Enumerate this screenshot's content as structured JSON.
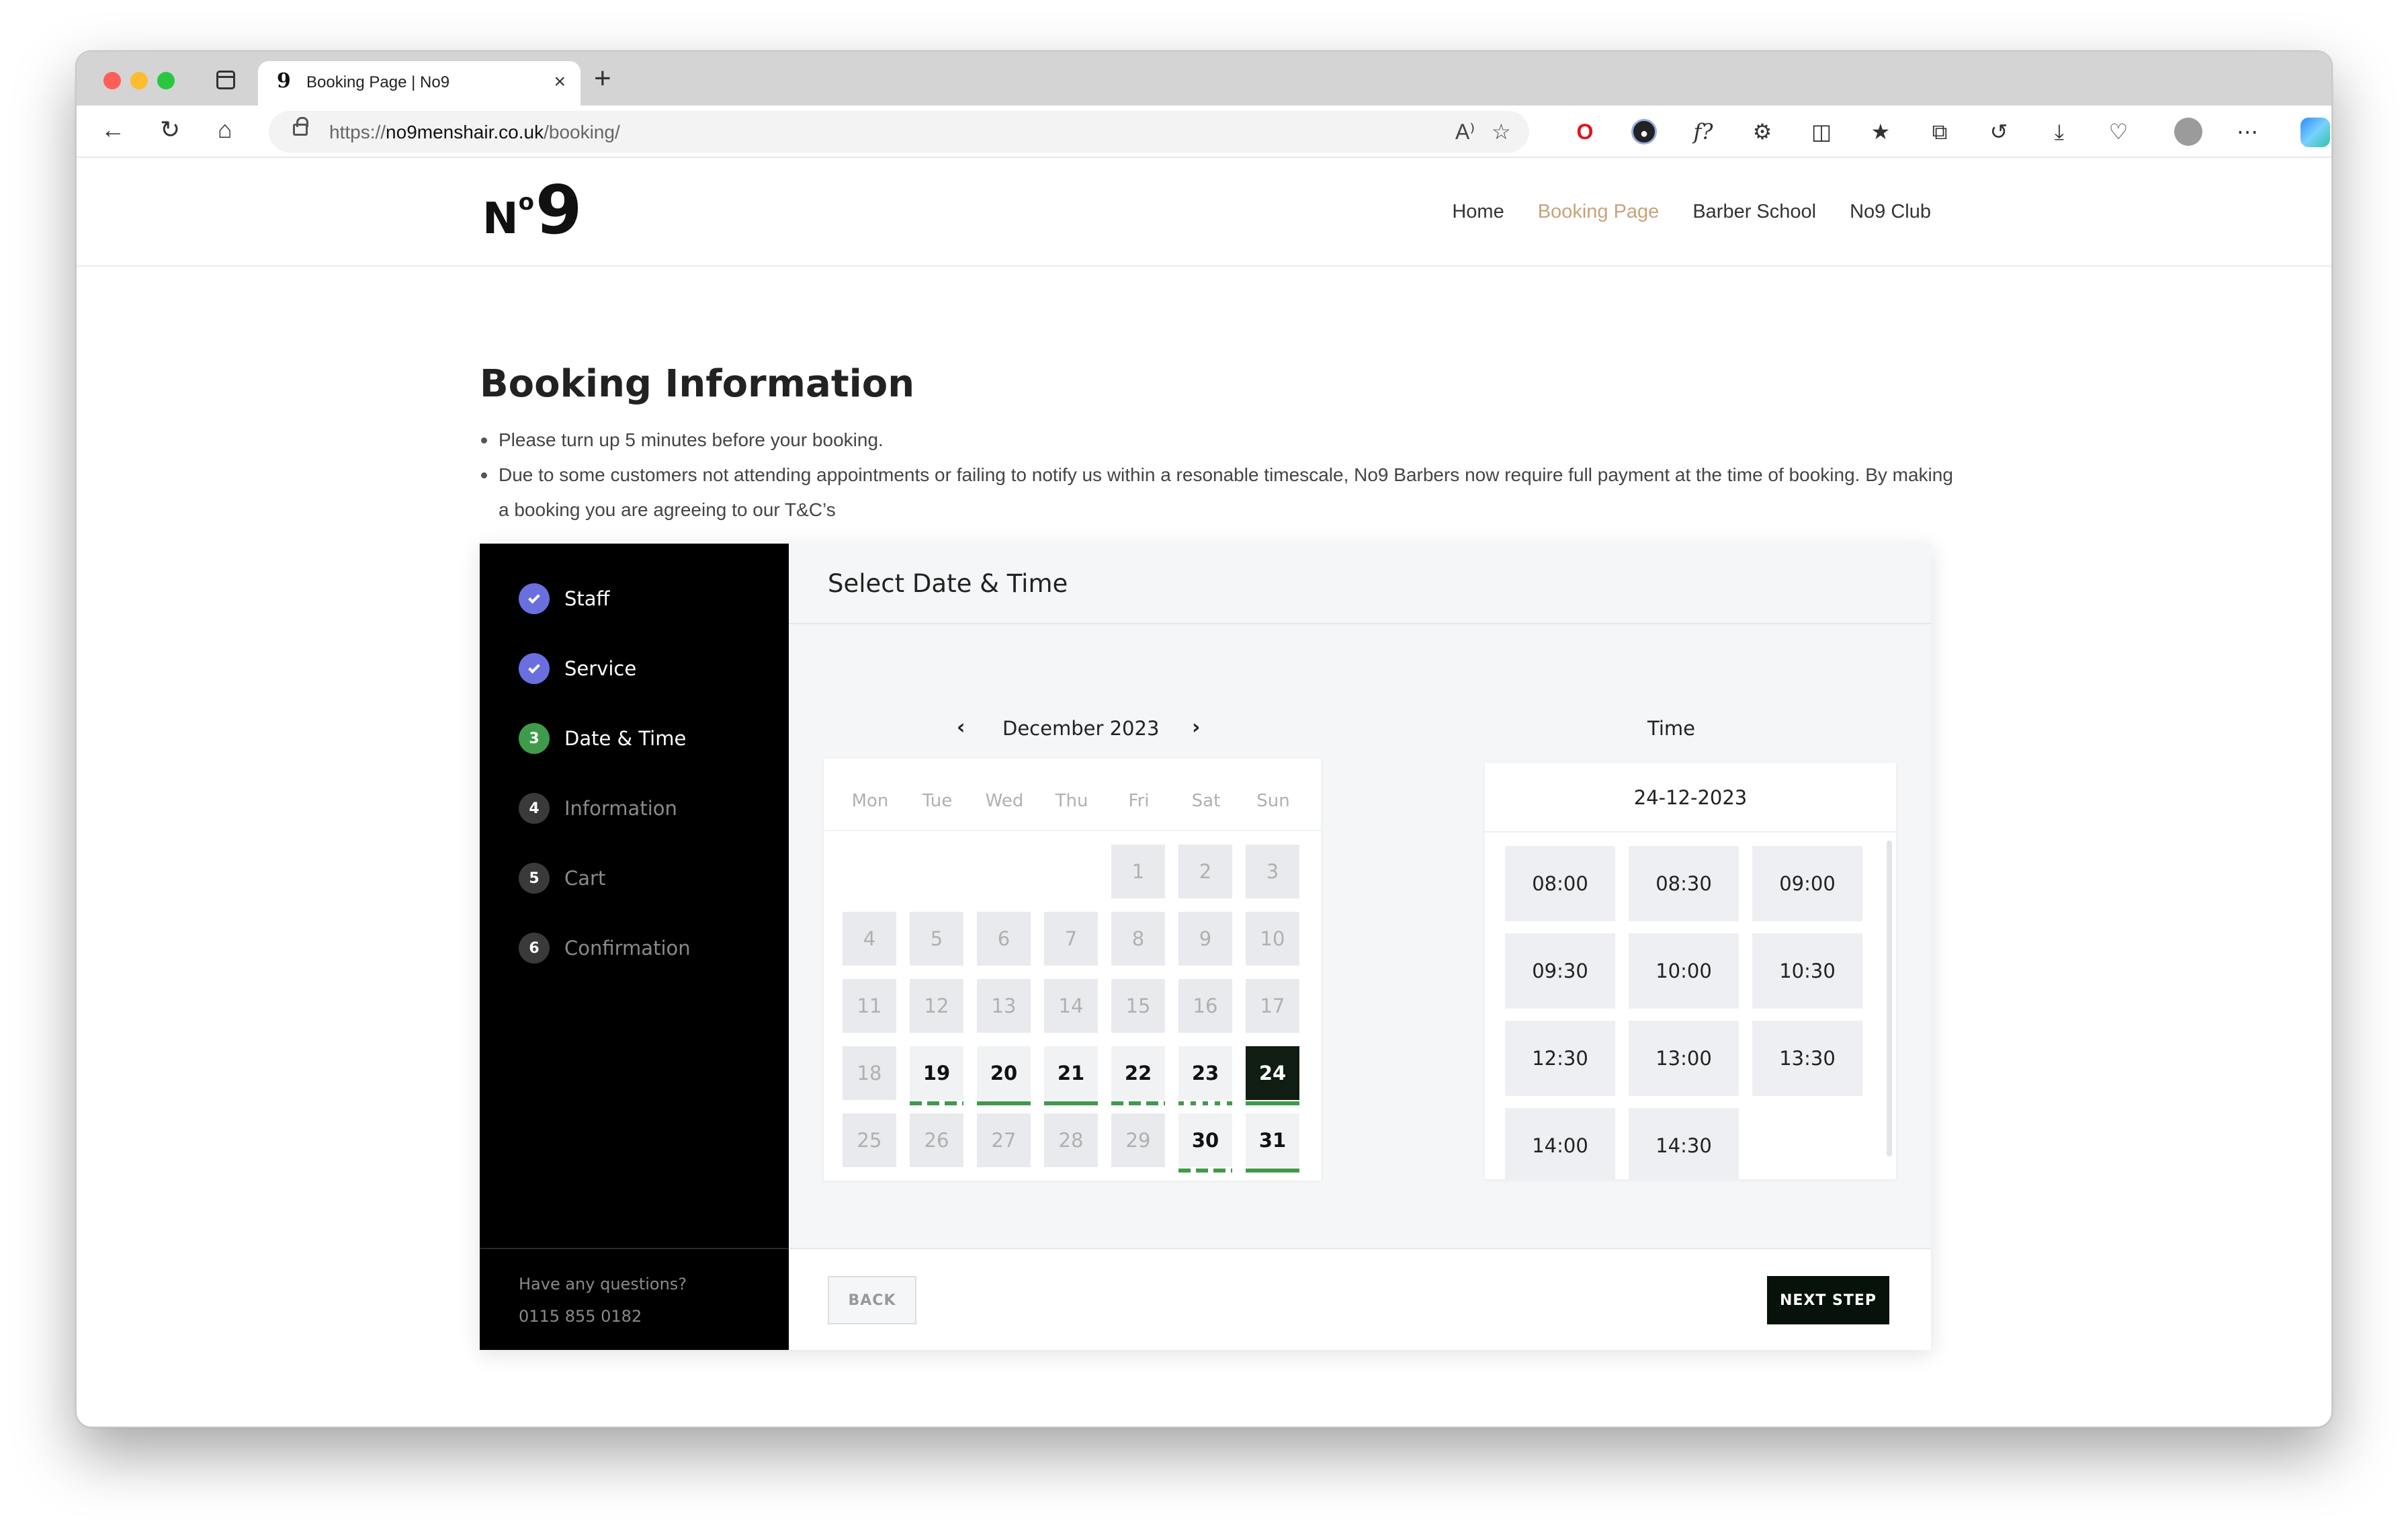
{
  "browser": {
    "tab_favicon": "9",
    "tab_title": "Booking Page | No9",
    "tab_close": "×",
    "new_tab": "+",
    "url_scheme": "https://",
    "url_host": "no9menshair.co.uk",
    "url_path": "/booking/",
    "read_aloud": "A⁾",
    "icons": [
      "back-icon",
      "reload-icon",
      "home-icon",
      "lock-icon",
      "read-aloud-icon",
      "favorite-icon",
      "opera-extension-icon",
      "circle-extension-icon",
      "function-extension-icon",
      "puzzle-extension-icon",
      "split-screen-icon",
      "favorites-list-icon",
      "collections-icon",
      "history-icon",
      "downloads-icon",
      "health-icon",
      "profile-icon",
      "more-icon",
      "copilot-icon"
    ]
  },
  "site": {
    "logo_n": "N",
    "logo_o": "o",
    "logo_9": "9",
    "nav": [
      "Home",
      "Booking Page",
      "Barber School",
      "No9 Club"
    ],
    "nav_active": "Booking Page"
  },
  "page": {
    "heading": "Booking Information",
    "bullets": [
      "Please turn up 5 minutes before your booking.",
      "Due to some customers not attending appointments or failing to notify us within a resonable timescale, No9 Barbers now require full payment at the time of booking. By making a booking you are agreeing to our T&C’s"
    ]
  },
  "steps": [
    {
      "num": "1",
      "label": "Staff",
      "state": "done"
    },
    {
      "num": "2",
      "label": "Service",
      "state": "done"
    },
    {
      "num": "3",
      "label": "Date & Time",
      "state": "current"
    },
    {
      "num": "4",
      "label": "Information",
      "state": "pending"
    },
    {
      "num": "5",
      "label": "Cart",
      "state": "pending"
    },
    {
      "num": "6",
      "label": "Confirmation",
      "state": "pending"
    }
  ],
  "help": {
    "question": "Have any questions?",
    "phone": "0115 855 0182"
  },
  "booking": {
    "title": "Select Date & Time",
    "prev": "‹",
    "next": "›",
    "month": "December 2023",
    "weekdays": [
      "Mon",
      "Tue",
      "Wed",
      "Thu",
      "Fri",
      "Sat",
      "Sun"
    ],
    "first_weekday_index": 4,
    "days_in_month": 31,
    "available_days": [
      19,
      20,
      21,
      22,
      23,
      24,
      30,
      31
    ],
    "selected_day": 24,
    "time_heading": "Time",
    "selected_date": "24-12-2023",
    "slots": [
      "08:00",
      "08:30",
      "09:00",
      "09:30",
      "10:00",
      "10:30",
      "12:30",
      "13:00",
      "13:30",
      "14:00",
      "14:30"
    ],
    "back_label": "BACK",
    "next_label": "NEXT STEP"
  },
  "colors": {
    "accent_nav": "#c9a27a",
    "step_done": "#6a6fe0",
    "step_current": "#3f9b4b",
    "selected_day": "#0f1d12",
    "available_bar": "#3f9b4b"
  }
}
